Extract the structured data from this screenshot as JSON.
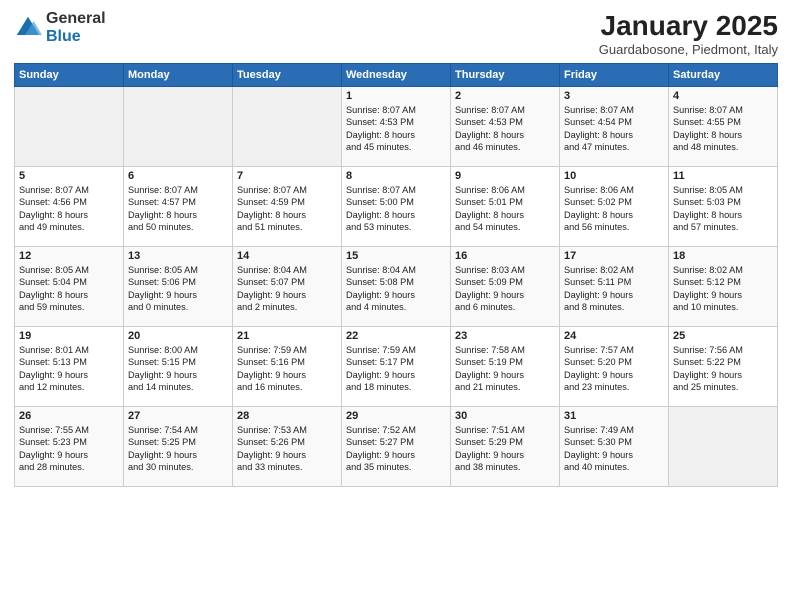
{
  "logo": {
    "general": "General",
    "blue": "Blue"
  },
  "title": "January 2025",
  "subtitle": "Guardabosone, Piedmont, Italy",
  "headers": [
    "Sunday",
    "Monday",
    "Tuesday",
    "Wednesday",
    "Thursday",
    "Friday",
    "Saturday"
  ],
  "weeks": [
    [
      {
        "day": "",
        "info": ""
      },
      {
        "day": "",
        "info": ""
      },
      {
        "day": "",
        "info": ""
      },
      {
        "day": "1",
        "info": "Sunrise: 8:07 AM\nSunset: 4:53 PM\nDaylight: 8 hours\nand 45 minutes."
      },
      {
        "day": "2",
        "info": "Sunrise: 8:07 AM\nSunset: 4:53 PM\nDaylight: 8 hours\nand 46 minutes."
      },
      {
        "day": "3",
        "info": "Sunrise: 8:07 AM\nSunset: 4:54 PM\nDaylight: 8 hours\nand 47 minutes."
      },
      {
        "day": "4",
        "info": "Sunrise: 8:07 AM\nSunset: 4:55 PM\nDaylight: 8 hours\nand 48 minutes."
      }
    ],
    [
      {
        "day": "5",
        "info": "Sunrise: 8:07 AM\nSunset: 4:56 PM\nDaylight: 8 hours\nand 49 minutes."
      },
      {
        "day": "6",
        "info": "Sunrise: 8:07 AM\nSunset: 4:57 PM\nDaylight: 8 hours\nand 50 minutes."
      },
      {
        "day": "7",
        "info": "Sunrise: 8:07 AM\nSunset: 4:59 PM\nDaylight: 8 hours\nand 51 minutes."
      },
      {
        "day": "8",
        "info": "Sunrise: 8:07 AM\nSunset: 5:00 PM\nDaylight: 8 hours\nand 53 minutes."
      },
      {
        "day": "9",
        "info": "Sunrise: 8:06 AM\nSunset: 5:01 PM\nDaylight: 8 hours\nand 54 minutes."
      },
      {
        "day": "10",
        "info": "Sunrise: 8:06 AM\nSunset: 5:02 PM\nDaylight: 8 hours\nand 56 minutes."
      },
      {
        "day": "11",
        "info": "Sunrise: 8:05 AM\nSunset: 5:03 PM\nDaylight: 8 hours\nand 57 minutes."
      }
    ],
    [
      {
        "day": "12",
        "info": "Sunrise: 8:05 AM\nSunset: 5:04 PM\nDaylight: 8 hours\nand 59 minutes."
      },
      {
        "day": "13",
        "info": "Sunrise: 8:05 AM\nSunset: 5:06 PM\nDaylight: 9 hours\nand 0 minutes."
      },
      {
        "day": "14",
        "info": "Sunrise: 8:04 AM\nSunset: 5:07 PM\nDaylight: 9 hours\nand 2 minutes."
      },
      {
        "day": "15",
        "info": "Sunrise: 8:04 AM\nSunset: 5:08 PM\nDaylight: 9 hours\nand 4 minutes."
      },
      {
        "day": "16",
        "info": "Sunrise: 8:03 AM\nSunset: 5:09 PM\nDaylight: 9 hours\nand 6 minutes."
      },
      {
        "day": "17",
        "info": "Sunrise: 8:02 AM\nSunset: 5:11 PM\nDaylight: 9 hours\nand 8 minutes."
      },
      {
        "day": "18",
        "info": "Sunrise: 8:02 AM\nSunset: 5:12 PM\nDaylight: 9 hours\nand 10 minutes."
      }
    ],
    [
      {
        "day": "19",
        "info": "Sunrise: 8:01 AM\nSunset: 5:13 PM\nDaylight: 9 hours\nand 12 minutes."
      },
      {
        "day": "20",
        "info": "Sunrise: 8:00 AM\nSunset: 5:15 PM\nDaylight: 9 hours\nand 14 minutes."
      },
      {
        "day": "21",
        "info": "Sunrise: 7:59 AM\nSunset: 5:16 PM\nDaylight: 9 hours\nand 16 minutes."
      },
      {
        "day": "22",
        "info": "Sunrise: 7:59 AM\nSunset: 5:17 PM\nDaylight: 9 hours\nand 18 minutes."
      },
      {
        "day": "23",
        "info": "Sunrise: 7:58 AM\nSunset: 5:19 PM\nDaylight: 9 hours\nand 21 minutes."
      },
      {
        "day": "24",
        "info": "Sunrise: 7:57 AM\nSunset: 5:20 PM\nDaylight: 9 hours\nand 23 minutes."
      },
      {
        "day": "25",
        "info": "Sunrise: 7:56 AM\nSunset: 5:22 PM\nDaylight: 9 hours\nand 25 minutes."
      }
    ],
    [
      {
        "day": "26",
        "info": "Sunrise: 7:55 AM\nSunset: 5:23 PM\nDaylight: 9 hours\nand 28 minutes."
      },
      {
        "day": "27",
        "info": "Sunrise: 7:54 AM\nSunset: 5:25 PM\nDaylight: 9 hours\nand 30 minutes."
      },
      {
        "day": "28",
        "info": "Sunrise: 7:53 AM\nSunset: 5:26 PM\nDaylight: 9 hours\nand 33 minutes."
      },
      {
        "day": "29",
        "info": "Sunrise: 7:52 AM\nSunset: 5:27 PM\nDaylight: 9 hours\nand 35 minutes."
      },
      {
        "day": "30",
        "info": "Sunrise: 7:51 AM\nSunset: 5:29 PM\nDaylight: 9 hours\nand 38 minutes."
      },
      {
        "day": "31",
        "info": "Sunrise: 7:49 AM\nSunset: 5:30 PM\nDaylight: 9 hours\nand 40 minutes."
      },
      {
        "day": "",
        "info": ""
      }
    ]
  ]
}
